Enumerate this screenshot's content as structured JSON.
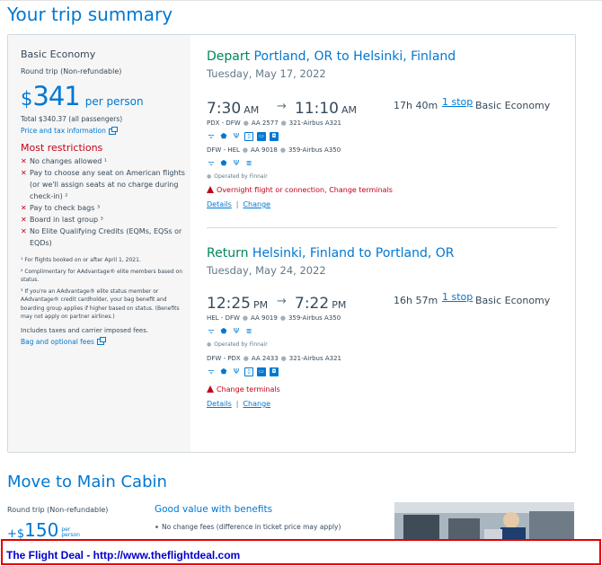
{
  "page_title": "Your trip summary",
  "fare": {
    "name": "Basic Economy",
    "trip_type": "Round trip (Non-refundable)",
    "currency_symbol": "$",
    "price": "341",
    "per_person": "per person",
    "total": "Total $340.37 (all passengers)",
    "price_tax_link": "Price and tax information",
    "restrictions_title": "Most restrictions",
    "restrictions": [
      "No changes allowed ¹",
      "Pay to choose any seat on American flights (or we'll assign seats at no charge during check-in) ²",
      "Pay to check bags ³",
      "Board in last group ³",
      "No Elite Qualifying Credits (EQMs, EQSs or EQDs)"
    ],
    "notes": [
      "¹ For flights booked on or after April 1, 2021.",
      "² Complimentary for AAdvantage® elite members based on status.",
      "³ If you're an AAdvantage® elite status member or AAdvantage® credit cardholder, your bag benefit and boarding group applies if higher based on status. (Benefits may not apply on partner airlines.)"
    ],
    "includes": "Includes taxes and carrier imposed fees.",
    "bag_link": "Bag and optional fees"
  },
  "depart": {
    "direction": "Depart",
    "route": " Portland, OR to Helsinki, Finland",
    "date": "Tuesday, May 17, 2022",
    "dep_time": "7:30",
    "dep_ampm": "AM",
    "arrow": "→",
    "arr_time": "11:10",
    "arr_ampm": "AM",
    "duration": "17h 40m",
    "stops": "1 stop",
    "cabin": "Basic Economy",
    "legs": [
      {
        "route": "PDX - DFW",
        "flight": "AA 2577",
        "aircraft": "321-Airbus A321"
      },
      {
        "route": "DFW - HEL",
        "flight": "AA 9018",
        "aircraft": "359-Airbus A350"
      }
    ],
    "operated_by": "Operated by Finnair",
    "warning": "Overnight flight or connection, Change terminals",
    "details_link": "Details",
    "separator": "|",
    "change_link": "Change"
  },
  "return": {
    "direction": "Return",
    "route": " Helsinki, Finland to Portland, OR",
    "date": "Tuesday, May 24, 2022",
    "dep_time": "12:25",
    "dep_ampm": "PM",
    "arrow": "→",
    "arr_time": "7:22",
    "arr_ampm": "PM",
    "duration": "16h 57m",
    "stops": "1 stop",
    "cabin": "Basic Economy",
    "legs": [
      {
        "route": "HEL - DFW",
        "flight": "AA 9019",
        "aircraft": "359-Airbus A350"
      },
      {
        "route": "DFW - PDX",
        "flight": "AA 2433",
        "aircraft": "321-Airbus A321"
      }
    ],
    "operated_by": "Operated by Finnair",
    "warning": "Change terminals",
    "details_link": "Details",
    "separator": "|",
    "change_link": "Change"
  },
  "main_cabin": {
    "title": "Move to Main Cabin",
    "trip_type": "Round trip (Non-refundable)",
    "plus": "+$",
    "price": "150",
    "per": "per",
    "person": "person",
    "value_title": "Good value with benefits",
    "benefits": [
      "No change fees (difference in ticket price may apply)"
    ]
  },
  "banner": "The Flight Deal - http://www.theflightdeal.com",
  "colors": {
    "brand_blue": "#0078d2",
    "depart_green": "#00875a",
    "restriction_red": "#c30019",
    "banner_red": "#e00000",
    "banner_text": "#0000cc"
  }
}
